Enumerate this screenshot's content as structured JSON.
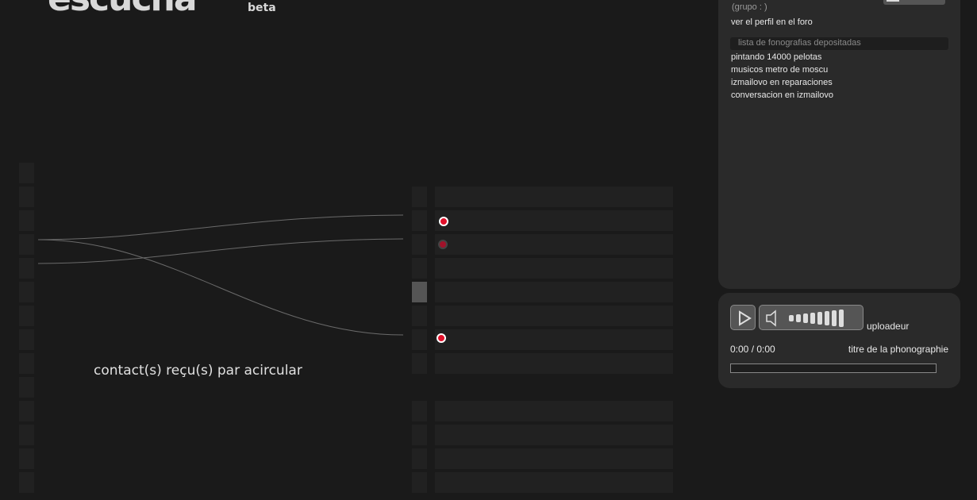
{
  "logo": {
    "word": "escucha",
    "badge": "beta"
  },
  "caption": "contact(s) reçu(s) par acircular",
  "profile": {
    "group_label": "(grupo : )",
    "forum_link": "ver el perfil en el foro"
  },
  "tracks": {
    "header": "lista de fonografias depositadas",
    "items": [
      "pintando 14000 pelotas",
      "musicos metro de moscu",
      "izmailovo en reparaciones",
      "conversacion en izmailovo"
    ]
  },
  "player": {
    "uploader": "uploadeur",
    "time": "0:00 / 0:00",
    "title": "titre de la phonographie",
    "progress": 0,
    "volume_level": 0.7
  },
  "icons": {
    "play": "play-icon",
    "volume": "speaker-icon"
  },
  "colors": {
    "background": "#1a1a1a",
    "panel": "#2a2a2a",
    "accent_dot": "#e0102a"
  }
}
